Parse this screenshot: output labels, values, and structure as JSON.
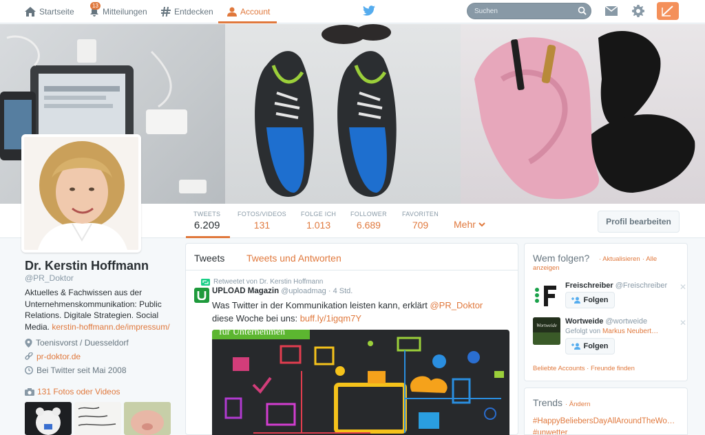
{
  "nav": {
    "home_label": "Startseite",
    "notifications_label": "Mitteilungen",
    "notifications_badge": "13",
    "discover_label": "Entdecken",
    "account_label": "Account",
    "search_placeholder": "Suchen"
  },
  "profile": {
    "name": "Dr. Kerstin Hoffmann",
    "handle": "@PR_Doktor",
    "bio": "Aktuelles & Fachwissen aus der Unternehmenskommunikation: Public Relations. Digitale Strategien. Social Media.",
    "bio_link": "kerstin-hoffmann.de/impressum/",
    "location": "Toenisvorst / Duesseldorf",
    "website": "pr-doktor.de",
    "joined": "Bei Twitter seit Mai 2008",
    "photos_label": "131 Fotos oder Videos",
    "edit_button": "Profil bearbeiten"
  },
  "stats": [
    {
      "label": "TWEETS",
      "value": "6.209"
    },
    {
      "label": "FOTOS/VIDEOS",
      "value": "131"
    },
    {
      "label": "FOLGE ICH",
      "value": "1.013"
    },
    {
      "label": "FOLLOWER",
      "value": "6.689"
    },
    {
      "label": "FAVORITEN",
      "value": "709"
    }
  ],
  "more_label": "Mehr",
  "timeline": {
    "tab_tweets": "Tweets",
    "tab_replies": "Tweets und Antworten",
    "tweet": {
      "retweeted_by": "Retweetet von Dr. Kerstin Hoffmann",
      "author_name": "UPLOAD Magazin",
      "author_handle": "@uploadmag",
      "time": "· 4 Std.",
      "text_before": "Was Twitter in der Kommunikation leisten kann, erklärt",
      "mention": "@PR_Doktor",
      "text_after": "diese Woche bei uns:",
      "link": "buff.ly/1igqm7Y",
      "media_caption": "für Unternehmen"
    }
  },
  "wtf": {
    "title": "Wem folgen?",
    "refresh": "· Aktualisieren",
    "all": "· Alle",
    "view_all": "anzeigen",
    "items": [
      {
        "name": "Freischreiber",
        "handle": "@Freischreiber",
        "subtitle": "",
        "subtitle_link": "",
        "follow": "Folgen"
      },
      {
        "name": "Wortweide",
        "handle": "@wortweide",
        "subtitle": "Gefolgt von",
        "subtitle_link": "Markus Neubert…",
        "follow": "Folgen",
        "avatar_text": "Wortweide"
      }
    ],
    "footer": "Beliebte Accounts · Freunde finden"
  },
  "trends": {
    "title": "Trends",
    "change": "· Ändern",
    "items": [
      "#HappyBeliebersDayAllAroundTheWo…",
      "#unwetter"
    ]
  },
  "colors": {
    "accent": "#e0783c",
    "text": "#292f33",
    "muted": "#8899a6",
    "background": "#f5f8fa"
  }
}
